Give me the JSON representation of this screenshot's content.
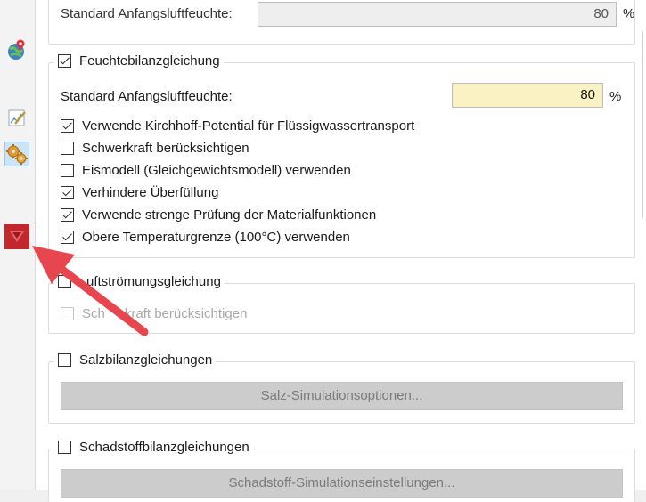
{
  "top_partial": {
    "label": "Standard Anfangsluftfeuchte:",
    "value": "80",
    "unit": "%"
  },
  "moisture": {
    "title": "Feuchtebilanzgleichung",
    "checked": true,
    "field_label": "Standard Anfangsluftfeuchte:",
    "field_value": "80",
    "field_unit": "%",
    "options": [
      {
        "label": "Verwende Kirchhoff-Potential für Flüssigwassertransport",
        "checked": true
      },
      {
        "label": "Schwerkraft berücksichtigen",
        "checked": false
      },
      {
        "label": "Eismodell (Gleichgewichtsmodell) verwenden",
        "checked": false
      },
      {
        "label": "Verhindere Überfüllung",
        "checked": true
      },
      {
        "label": "Verwende strenge Prüfung der Materialfunktionen",
        "checked": true
      },
      {
        "label": "Obere Temperaturgrenze (100°C) verwenden",
        "checked": true
      }
    ]
  },
  "airflow": {
    "title_visible": "uftströmungsgleichung",
    "checked": false,
    "option_part1": "Sch",
    "option_part2": "kraft berücksichtigen"
  },
  "salt": {
    "title": "Salzbilanzgleichungen",
    "checked": false,
    "button": "Salz-Simulationsoptionen..."
  },
  "pollutant": {
    "title": "Schadstoffbilanzgleichungen",
    "checked": false,
    "button": "Schadstoff-Simulationseinstellungen..."
  },
  "colors": {
    "highlight_input": "#fbf2c3",
    "disabled_input": "#eeeeee",
    "arrow": "#e8464f",
    "selected_icon_bg": "#cce4f7"
  },
  "sidebar_icons": [
    "globe-pin-icon",
    "chart-pencil-icon",
    "gears-icon",
    "red-pointer-icon"
  ]
}
